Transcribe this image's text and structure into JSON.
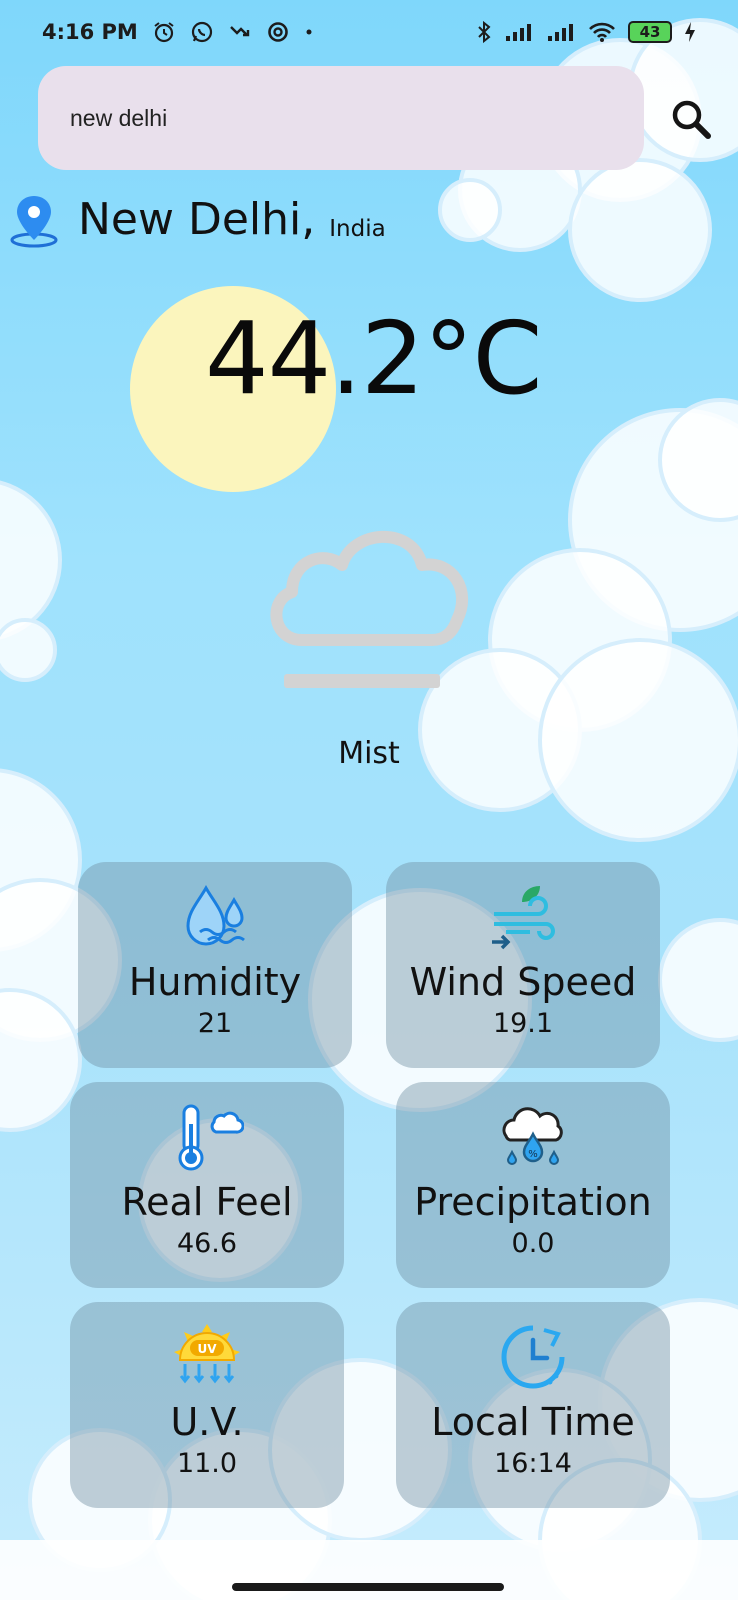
{
  "status_bar": {
    "time": "4:16 PM",
    "battery": "43"
  },
  "search": {
    "value": "new delhi",
    "placeholder": ""
  },
  "location": {
    "city": "New Delhi,",
    "country": "India"
  },
  "weather": {
    "temperature": "44.2°C",
    "condition": "Mist"
  },
  "cards": [
    {
      "label": "Humidity",
      "value": "21",
      "icon": "humidity-icon"
    },
    {
      "label": "Wind Speed",
      "value": "19.1",
      "icon": "wind-icon"
    },
    {
      "label": "Real Feel",
      "value": "46.6",
      "icon": "thermometer-icon"
    },
    {
      "label": "Precipitation",
      "value": "0.0",
      "icon": "precipitation-icon"
    },
    {
      "label": "U.V.",
      "value": "11.0",
      "icon": "uv-icon"
    },
    {
      "label": "Local Time",
      "value": "16:14",
      "icon": "clock-icon"
    }
  ],
  "colors": {
    "sky_top": "#7fd7fb",
    "search_bg": "#e9e0ec",
    "sun": "#fbf5bd",
    "card_bg": "rgba(110,140,160,0.42)"
  }
}
